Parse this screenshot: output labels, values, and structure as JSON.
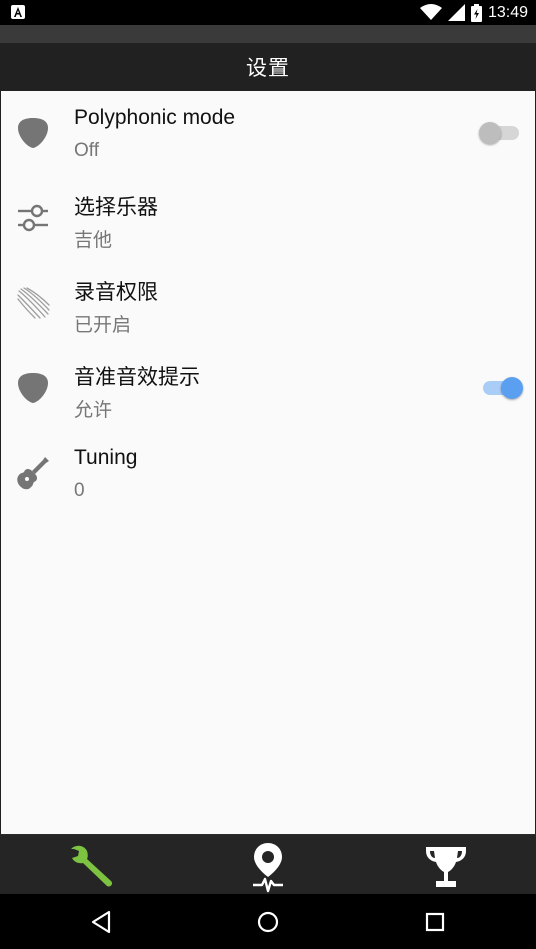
{
  "status_bar": {
    "time": "13:49",
    "icons": [
      "notification-a-icon",
      "wifi-icon",
      "signal-icon",
      "battery-icon"
    ]
  },
  "app_bar": {
    "title": "设置"
  },
  "settings": [
    {
      "icon": "guitar-pick-icon",
      "title": "Polyphonic mode",
      "subtitle": "Off",
      "toggle": "off"
    },
    {
      "icon": "sliders-icon",
      "title": "选择乐器",
      "subtitle": "吉他",
      "toggle": null
    },
    {
      "icon": "sound-waves-icon",
      "title": "录音权限",
      "subtitle": "已开启",
      "toggle": null
    },
    {
      "icon": "guitar-pick-icon",
      "title": "音准音效提示",
      "subtitle": "允许",
      "toggle": "on"
    },
    {
      "icon": "guitar-icon",
      "title": "Tuning",
      "subtitle": "0",
      "toggle": null
    }
  ],
  "bottom_nav": [
    {
      "icon": "wrench-icon",
      "active": true
    },
    {
      "icon": "tuner-pin-icon",
      "active": false
    },
    {
      "icon": "trophy-icon",
      "active": false
    }
  ],
  "colors": {
    "accent_active": "#7ec242",
    "toggle_on": "#5a9ff0",
    "appbar": "#212121"
  }
}
